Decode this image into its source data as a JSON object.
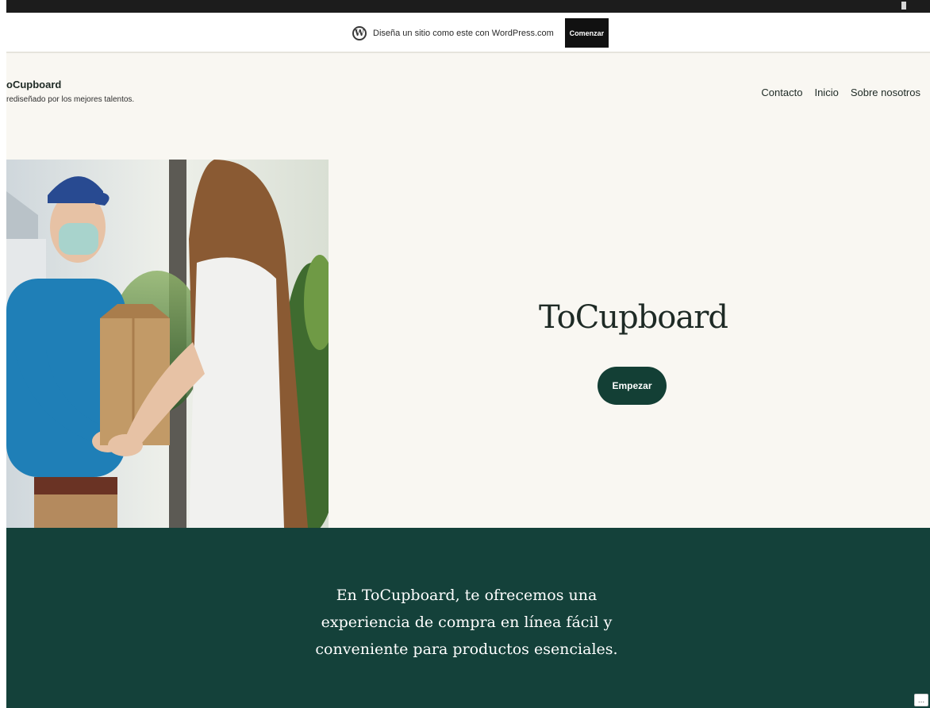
{
  "promo": {
    "text": "Diseña un sitio como este con WordPress.com",
    "button_label": "Comenzar"
  },
  "site": {
    "title": "oCupboard",
    "tagline": "rediseñado por los mejores talentos."
  },
  "nav": {
    "items": [
      {
        "label": "Contacto"
      },
      {
        "label": "Inicio"
      },
      {
        "label": "Sobre nosotros"
      }
    ]
  },
  "hero": {
    "title": "ToCupboard",
    "button_label": "Empezar"
  },
  "band": {
    "text": "En ToCupboard, te ofrecemos una experiencia de compra en línea fácil y conveniente para productos esenciales."
  },
  "more_button": {
    "label": "..."
  },
  "colors": {
    "accent": "#133f35",
    "band": "#14413a",
    "page_bg": "#f9f7f2"
  }
}
